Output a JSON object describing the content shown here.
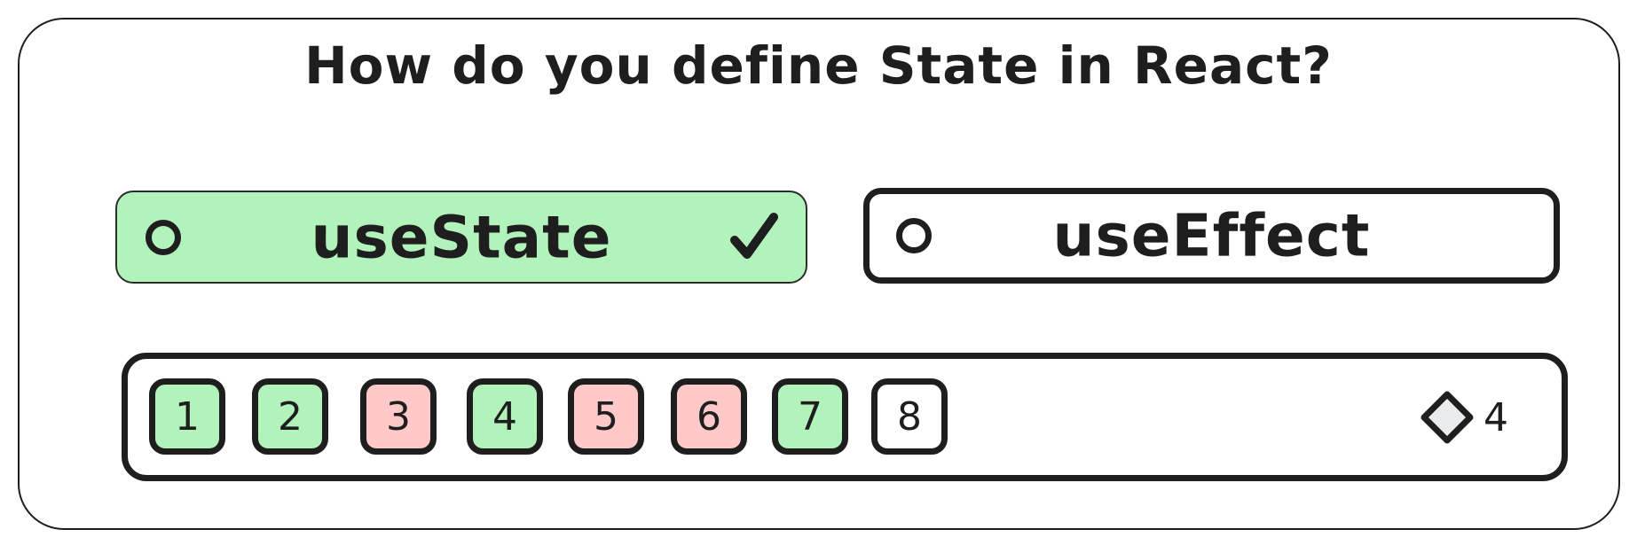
{
  "question": {
    "text": "How do you define State in React?"
  },
  "options": [
    {
      "label": "useState",
      "status": "correct",
      "marker": "checkmark-icon"
    },
    {
      "label": "useEffect",
      "status": "neutral"
    }
  ],
  "progress": {
    "questions": [
      {
        "number": "1",
        "state": "correct"
      },
      {
        "number": "2",
        "state": "correct"
      },
      {
        "number": "3",
        "state": "incorrect"
      },
      {
        "number": "4",
        "state": "correct"
      },
      {
        "number": "5",
        "state": "incorrect"
      },
      {
        "number": "6",
        "state": "incorrect"
      },
      {
        "number": "7",
        "state": "correct"
      },
      {
        "number": "8",
        "state": "unanswered"
      }
    ],
    "score_icon": "diamond-icon",
    "score": "4"
  },
  "colors": {
    "correct": "#b2f2bb",
    "incorrect": "#ffc9c9",
    "unanswered": "#ffffff",
    "stroke": "#1e1e1e",
    "diamond_fill": "#e9ecef"
  }
}
